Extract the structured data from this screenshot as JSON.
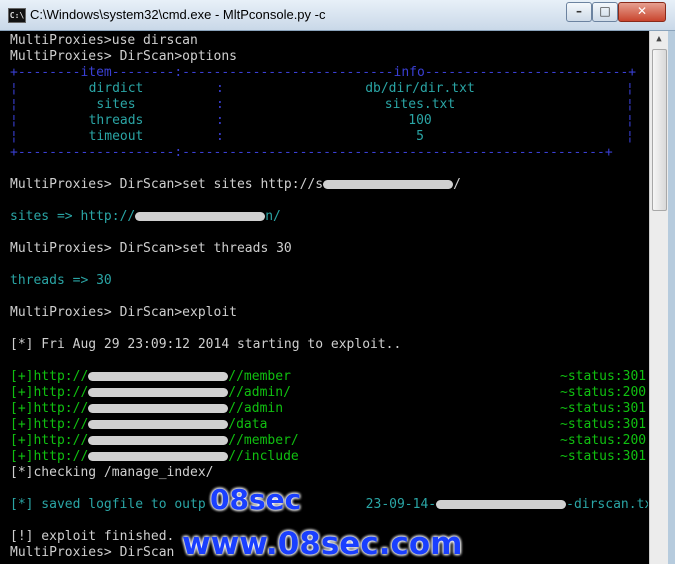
{
  "window": {
    "title": "C:\\Windows\\system32\\cmd.exe - MltPconsole.py  -c",
    "icon_label": "C:\\"
  },
  "controls": {
    "minimize": "–",
    "maximize": "□",
    "close": "✕"
  },
  "console": {
    "cmd_use": "MultiProxies>use dirscan",
    "cmd_options": "MultiProxies> DirScan>options",
    "table": {
      "border_top": "+--------item--------:---------------------------info--------------------------+",
      "border_bottom": "+--------------------:------------------------------------------------------+",
      "rows": [
        {
          "item": "dirdict",
          "info": "db/dir/dir.txt"
        },
        {
          "item": "sites",
          "info": "sites.txt"
        },
        {
          "item": "threads",
          "info": "100"
        },
        {
          "item": "timeout",
          "info": "5"
        }
      ]
    },
    "cmd_set_sites": "MultiProxies> DirScan>set sites http://s",
    "cmd_set_sites_tail": "/",
    "sites_result": "sites => http://",
    "sites_result_tail": "n/",
    "cmd_set_threads": "MultiProxies> DirScan>set threads 30",
    "threads_result": "threads => 30",
    "cmd_exploit": "MultiProxies> DirScan>exploit",
    "start_msg": "[*] Fri Aug 29 23:09:12 2014 starting to exploit..",
    "results": [
      {
        "prefix": "[+]http://",
        "path": "//member",
        "status": "~status:301"
      },
      {
        "prefix": "[+]http://",
        "path": "//admin/",
        "status": "~status:200"
      },
      {
        "prefix": "[+]http://",
        "path": "//admin",
        "status": "~status:301"
      },
      {
        "prefix": "[+]http://",
        "path": "/data",
        "status": "~status:301"
      },
      {
        "prefix": "[+]http://",
        "path": "//member/",
        "status": "~status:200"
      },
      {
        "prefix": "[+]http://",
        "path": "//include",
        "status": "~status:301"
      }
    ],
    "checking": "[*]checking /manage_index/",
    "saved_head": "[*] saved logfile to outp",
    "saved_mid": "23-09-14-",
    "saved_tail": "-dirscan.txt",
    "finished": "[!] exploit finished.",
    "last_prompt": "MultiProxies> DirScan"
  },
  "watermark": {
    "line1": "08sec",
    "line2": "www.08sec.com"
  },
  "colors": {
    "prompt": "#cfcfcf",
    "cyan": "#2aa5a5",
    "green": "#10c010",
    "table_border": "#3a3fd4",
    "watermark": "#1a3fff"
  }
}
